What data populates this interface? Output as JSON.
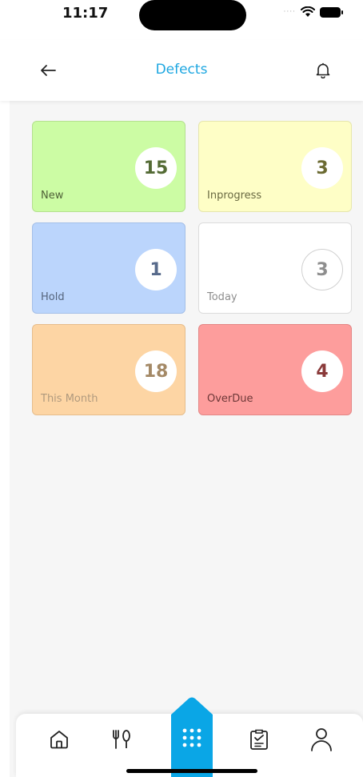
{
  "status_bar": {
    "time": "11:17"
  },
  "header": {
    "title": "Defects"
  },
  "cards": [
    {
      "label": "New",
      "count": "15",
      "bg": "#ccfca4",
      "border": "#b4e08e",
      "count_color": "#546b35",
      "label_color": "#4f6138"
    },
    {
      "label": "Inprogress",
      "count": "3",
      "bg": "#fefec6",
      "border": "#e6e6ad",
      "count_color": "#6b6a32",
      "label_color": "#6a6a42"
    },
    {
      "label": "Hold",
      "count": "1",
      "bg": "#bbd5fc",
      "border": "#a4bfe8",
      "count_color": "#576a8b",
      "label_color": "#55647c"
    },
    {
      "label": "Today",
      "count": "3",
      "bg": "#ffffff",
      "border": "#dcdcdc",
      "count_color": "#8e8e8e",
      "label_color": "#8e8e8e",
      "circle_border": "#d0d0d0"
    },
    {
      "label": "This Month",
      "count": "18",
      "bg": "#fdd5a4",
      "border": "#e6bd8c",
      "count_color": "#a48966",
      "label_color": "#b09a7e"
    },
    {
      "label": "OverDue",
      "count": "4",
      "bg": "#fd9d9c",
      "border": "#e38786",
      "count_color": "#8a3a3a",
      "label_color": "#6e3838"
    }
  ],
  "bottom_nav": {
    "accent": "#0aa6e6",
    "items": [
      "home-icon",
      "dining-icon",
      "apps-grid-icon",
      "checklist-icon",
      "profile-icon"
    ],
    "active": "apps-grid-icon"
  }
}
